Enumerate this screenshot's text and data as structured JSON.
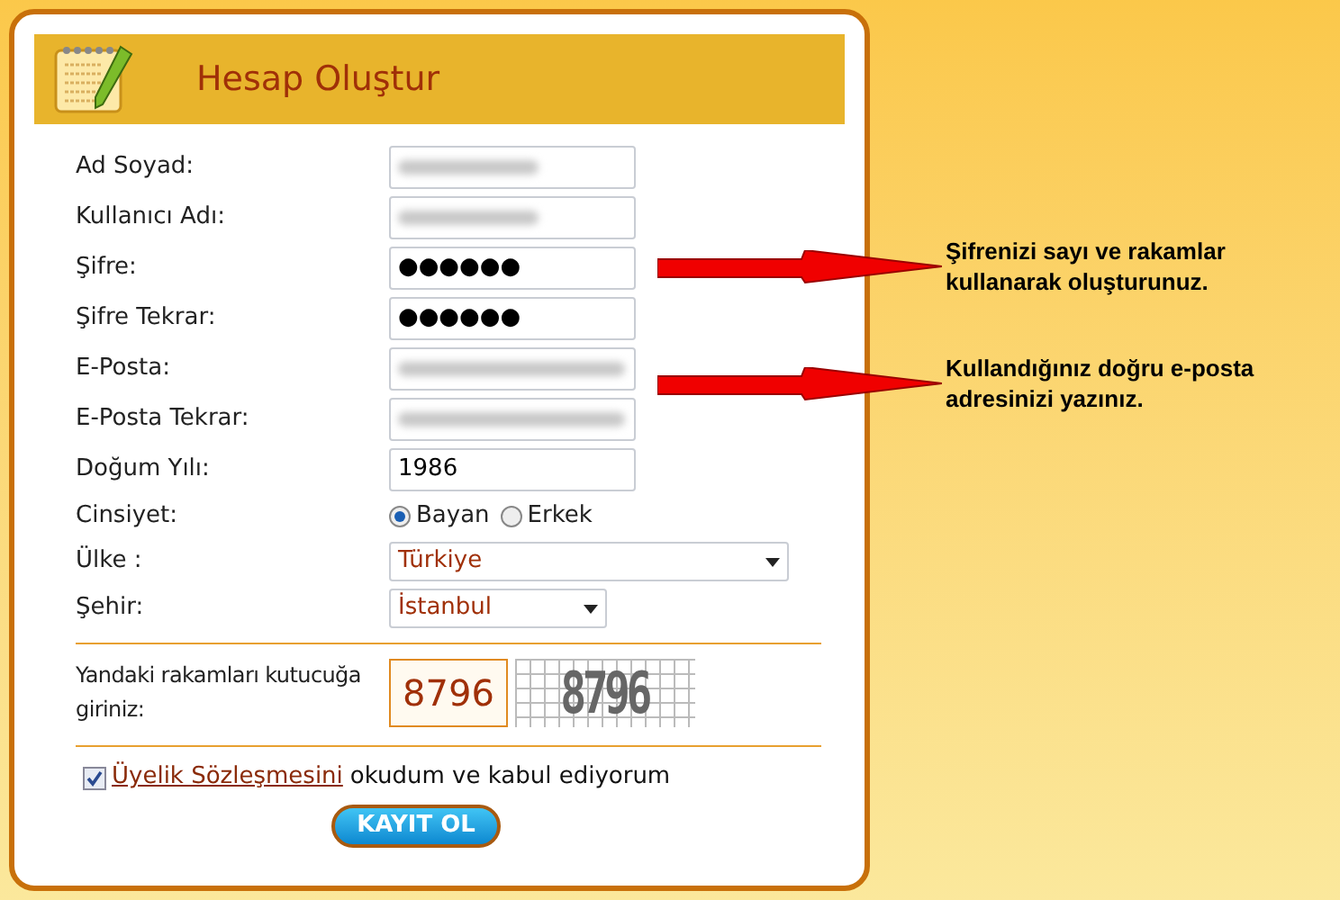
{
  "header": {
    "title": "Hesap Oluştur"
  },
  "fields": [
    {
      "label": "Ad Soyad:",
      "kind": "blurred"
    },
    {
      "label": "Kullanıcı Adı:",
      "kind": "blurred"
    },
    {
      "label": "Şifre:",
      "kind": "text",
      "value": "●●●●●●"
    },
    {
      "label": "Şifre Tekrar:",
      "kind": "text",
      "value": "●●●●●●"
    },
    {
      "label": "E-Posta:",
      "kind": "blurred_long"
    },
    {
      "label": "E-Posta Tekrar:",
      "kind": "blurred_long"
    },
    {
      "label": "Doğum Yılı:",
      "kind": "text",
      "value": "1986"
    }
  ],
  "gender": {
    "label": "Cinsiyet:",
    "options": [
      {
        "label": "Bayan",
        "selected": true
      },
      {
        "label": "Erkek",
        "selected": false
      }
    ]
  },
  "selects": [
    {
      "label": "Ülke :",
      "value": "Türkiye",
      "kind": "wide"
    },
    {
      "label": "Şehir:",
      "value": "İstanbul",
      "kind": "narrow"
    }
  ],
  "captcha": {
    "label": "Yandaki rakamları kutucuğa giriniz:",
    "value": "8796",
    "image_text": "8796"
  },
  "agreement": {
    "checked": true,
    "link": "Üyelik Sözleşmesini",
    "text": "okudum ve kabul ediyorum"
  },
  "submit": "KAYIT OL",
  "notes": [
    "Şifrenizi sayı ve rakamlar kullanarak oluşturunuz.",
    "Kullandığınız doğru e-posta adresinizi yazınız."
  ]
}
